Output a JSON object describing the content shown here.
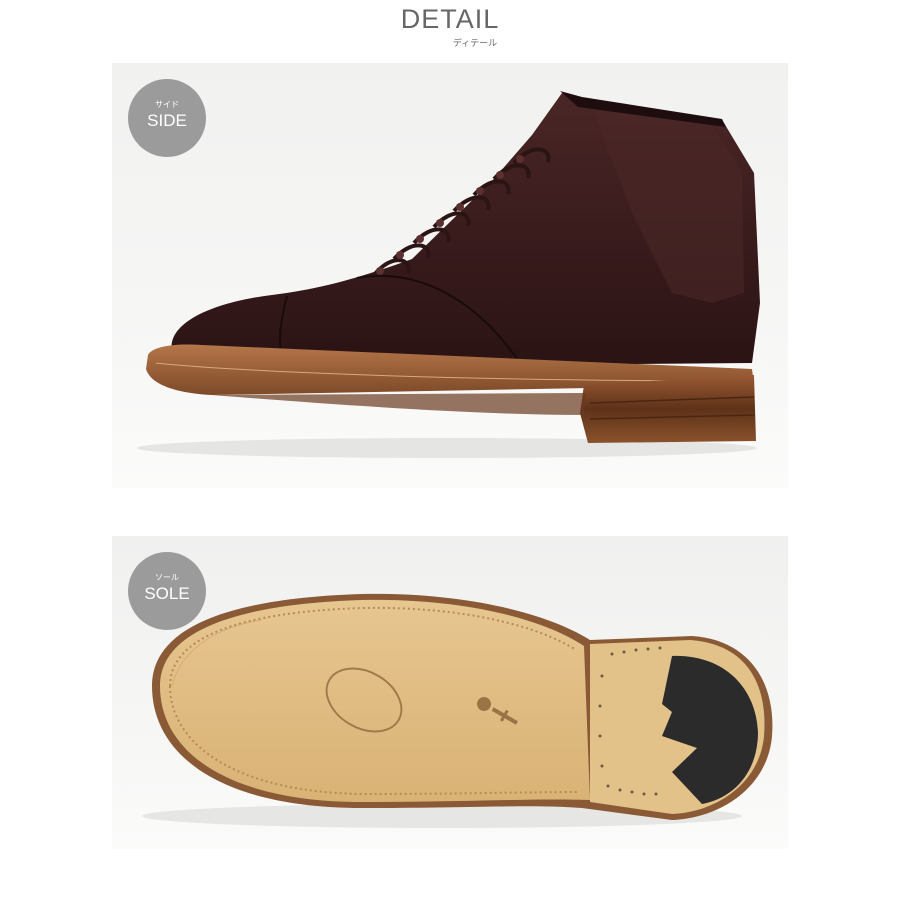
{
  "header": {
    "title": "DETAIL",
    "subtitle": "ディテール"
  },
  "panels": [
    {
      "badge_small": "サイド",
      "badge_label": "SIDE",
      "image_subject": "dark brown cap-toe lace-up boot, side view"
    },
    {
      "badge_small": "ソール",
      "badge_label": "SOLE",
      "image_subject": "natural leather sole with rubber heel, bottom view"
    }
  ],
  "colors": {
    "badge": "#9b9b9b",
    "title": "#666666",
    "leather": "#3b1e1e",
    "sole_leather": "#e2c18a",
    "welt": "#a0653b",
    "heel_rubber": "#2a2a2a"
  }
}
